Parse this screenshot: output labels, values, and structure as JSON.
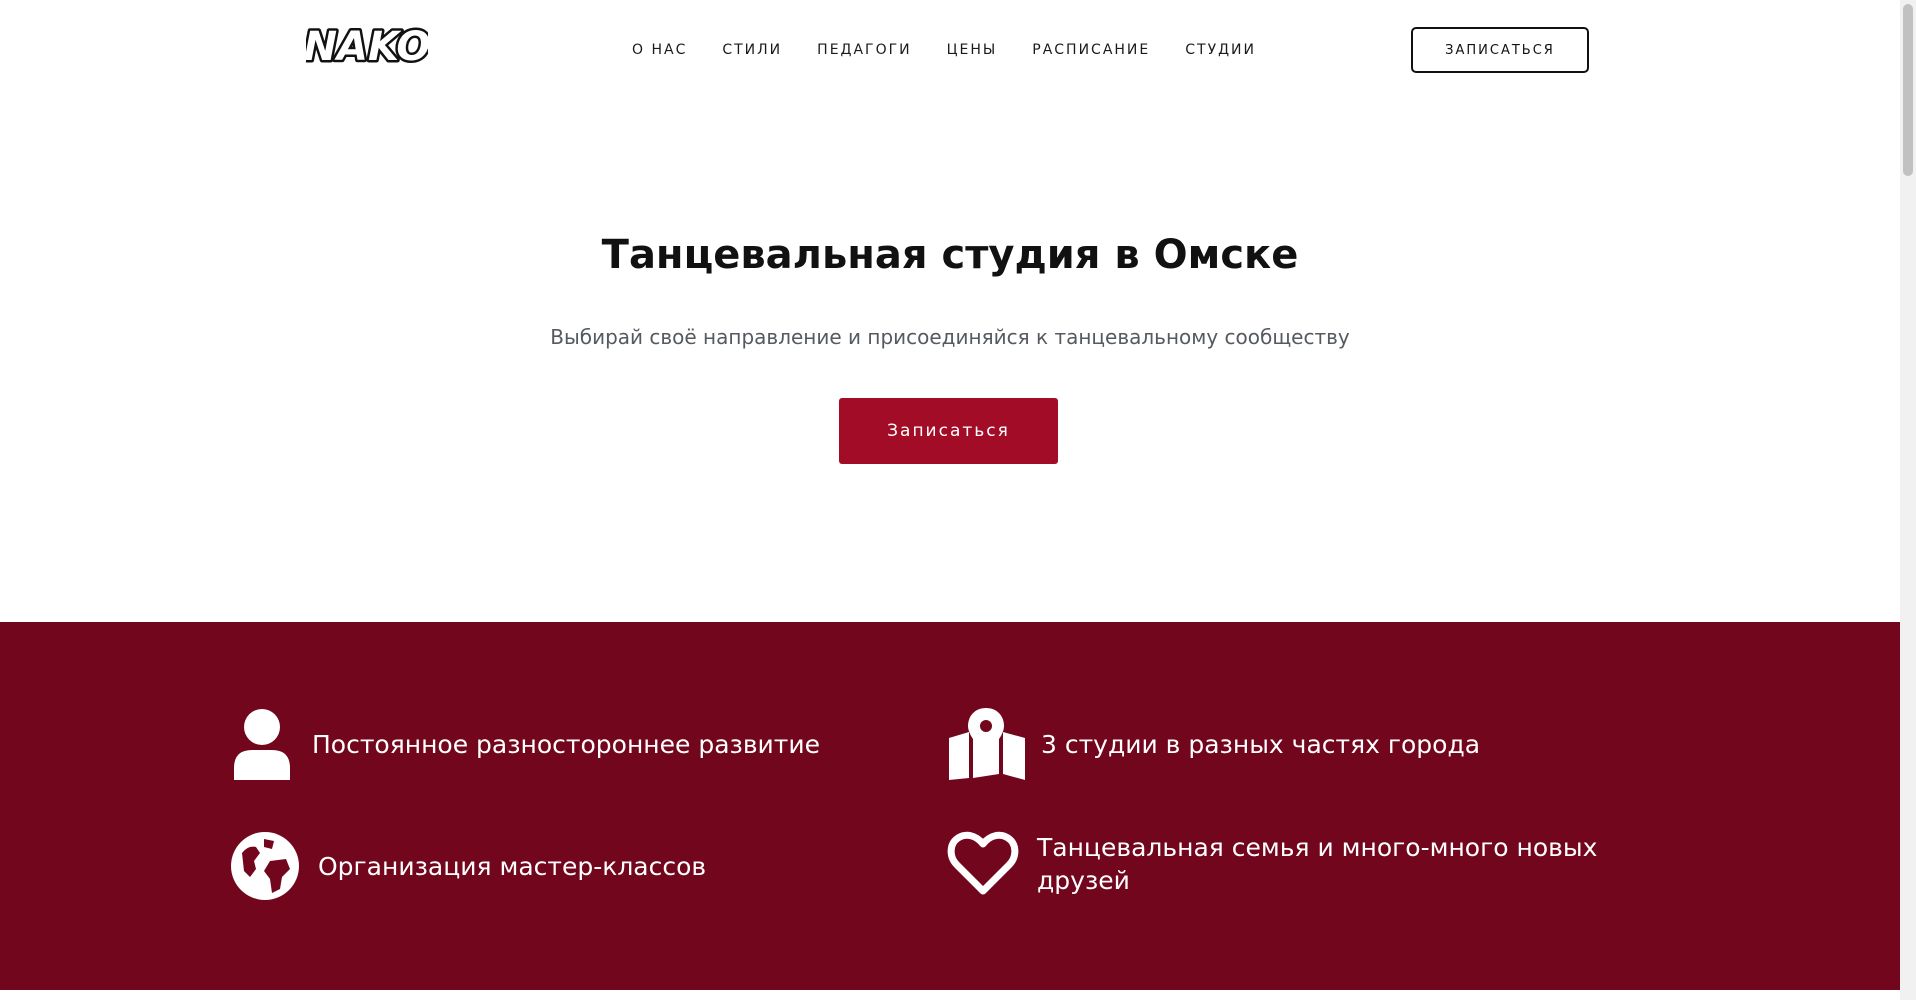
{
  "logo": {
    "text": "NAKO"
  },
  "nav": {
    "items": [
      {
        "label": "О НАС"
      },
      {
        "label": "СТИЛИ"
      },
      {
        "label": "ПЕДАГОГИ"
      },
      {
        "label": "ЦЕНЫ"
      },
      {
        "label": "РАСПИСАНИЕ"
      },
      {
        "label": "СТУДИИ"
      }
    ],
    "cta_label": "ЗАПИСАТЬСЯ"
  },
  "hero": {
    "title": "Танцевальная студия в Омске",
    "subtitle": "Выбирай своё направление и присоединяйся к танцевальному сообществу",
    "cta_label": "Записаться"
  },
  "features": {
    "background": "#72061c",
    "items": [
      {
        "icon": "user-icon",
        "text": "Постоянное разностороннее развитие"
      },
      {
        "icon": "map-marker-icon",
        "text": "3 студии в разных частях города"
      },
      {
        "icon": "globe-icon",
        "text": "Организация мастер-классов"
      },
      {
        "icon": "heart-icon",
        "text": "Танцевальная семья и много-много новых друзей"
      }
    ]
  },
  "colors": {
    "accent": "#a30c26",
    "band": "#72061c",
    "text": "#111111",
    "muted": "#555a60"
  }
}
